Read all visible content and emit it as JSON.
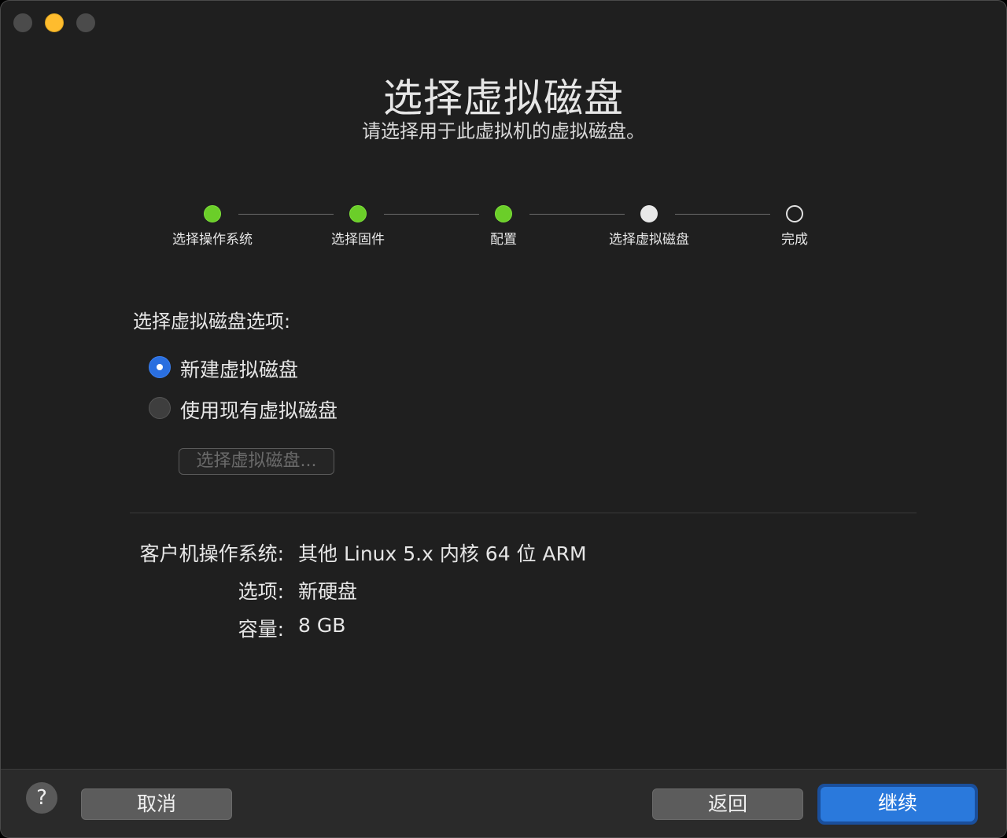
{
  "window": {
    "controls": [
      "close",
      "minimize",
      "zoom"
    ]
  },
  "header": {
    "title": "选择虚拟磁盘",
    "subtitle": "请选择用于此虚拟机的虚拟磁盘。"
  },
  "steps": [
    {
      "label": "选择操作系统",
      "state": "done"
    },
    {
      "label": "选择固件",
      "state": "done"
    },
    {
      "label": "配置",
      "state": "done"
    },
    {
      "label": "选择虚拟磁盘",
      "state": "current"
    },
    {
      "label": "完成",
      "state": "todo"
    }
  ],
  "options": {
    "section_label": "选择虚拟磁盘选项:",
    "new_disk_label": "新建虚拟磁盘",
    "new_disk_selected": true,
    "existing_disk_label": "使用现有虚拟磁盘",
    "existing_disk_selected": false,
    "choose_button_label": "选择虚拟磁盘...",
    "choose_button_enabled": false
  },
  "summary": {
    "os_key": "客户机操作系统:",
    "os_value": "其他 Linux 5.x 内核 64 位 ARM",
    "option_key": "选项:",
    "option_value": "新硬盘",
    "capacity_key": "容量:",
    "capacity_value": "8 GB"
  },
  "footer": {
    "help_label": "?",
    "cancel_label": "取消",
    "back_label": "返回",
    "continue_label": "继续"
  },
  "colors": {
    "window_bg": "#1f1f1f",
    "step_done": "#6bce29",
    "accent": "#2a79dc"
  }
}
